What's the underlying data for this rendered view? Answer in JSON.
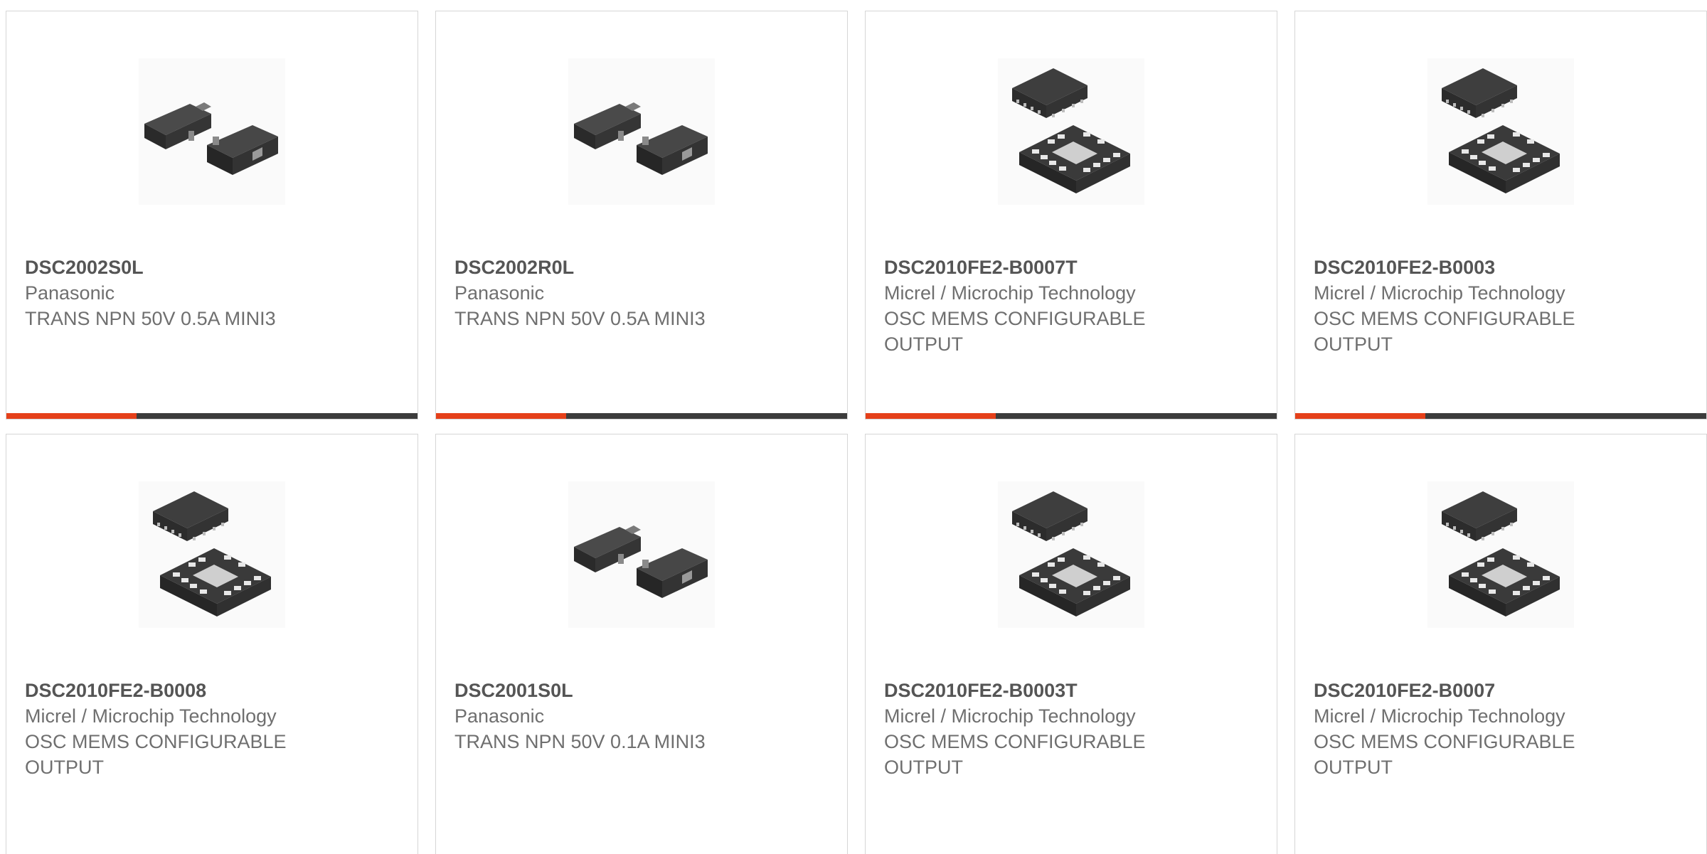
{
  "accent_color": "#e5401a",
  "products": [
    {
      "part_number": "DSC2002S0L",
      "manufacturer": "Panasonic",
      "description": "TRANS NPN 50V 0.5A MINI3",
      "package_icon": "sot23-transistor-icon"
    },
    {
      "part_number": "DSC2002R0L",
      "manufacturer": "Panasonic",
      "description": "TRANS NPN 50V 0.5A MINI3",
      "package_icon": "sot23-transistor-icon"
    },
    {
      "part_number": "DSC2010FE2-B0007T",
      "manufacturer": "Micrel / Microchip Technology",
      "description": "OSC MEMS CONFIGURABLE OUTPUT",
      "package_icon": "qfn-chip-icon"
    },
    {
      "part_number": "DSC2010FE2-B0003",
      "manufacturer": "Micrel / Microchip Technology",
      "description": "OSC MEMS CONFIGURABLE OUTPUT",
      "package_icon": "qfn-chip-icon"
    },
    {
      "part_number": "DSC2010FE2-B0008",
      "manufacturer": "Micrel / Microchip Technology",
      "description": "OSC MEMS CONFIGURABLE OUTPUT",
      "package_icon": "qfn-chip-icon"
    },
    {
      "part_number": "DSC2001S0L",
      "manufacturer": "Panasonic",
      "description": "TRANS NPN 50V 0.1A MINI3",
      "package_icon": "sot23-transistor-icon"
    },
    {
      "part_number": "DSC2010FE2-B0003T",
      "manufacturer": "Micrel / Microchip Technology",
      "description": "OSC MEMS CONFIGURABLE OUTPUT",
      "package_icon": "qfn-chip-icon"
    },
    {
      "part_number": "DSC2010FE2-B0007",
      "manufacturer": "Micrel / Microchip Technology",
      "description": "OSC MEMS CONFIGURABLE OUTPUT",
      "package_icon": "qfn-chip-icon"
    }
  ]
}
